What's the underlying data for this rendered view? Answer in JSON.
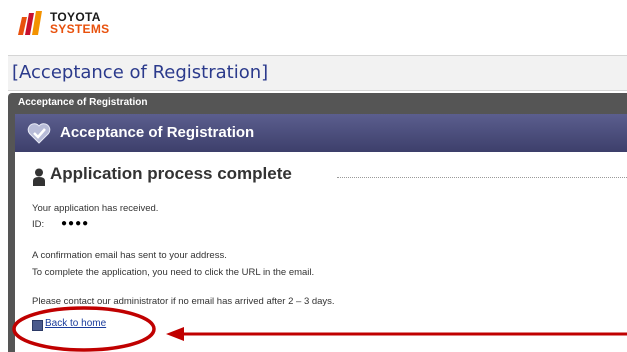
{
  "brand": {
    "line1": "TOYOTA",
    "line2": "SYSTEMS",
    "colors": {
      "orange": "#e8510d",
      "red": "#c8102e"
    }
  },
  "page": {
    "title": "[Acceptance of Registration]"
  },
  "panel": {
    "outer_header": "Acceptance of Registration",
    "inner_title": "Acceptance of Registration",
    "header_icon": "heart-check-icon"
  },
  "section": {
    "title": "Application process complete",
    "icon": "person-icon"
  },
  "body": {
    "received": "Your application has received.",
    "id_label": "ID:",
    "id_value": "●●●●",
    "confirm_line1": "A confirmation email has sent to your address.",
    "confirm_line2": "To complete the application, you need to click the URL in the email.",
    "contact": "Please contact our administrator if no email has arrived after 2 – 3 days."
  },
  "back_link": {
    "label": "Back to home",
    "icon": "back-square-icon"
  },
  "annotation": {
    "color": "#c00000",
    "highlight": "ellipse-around-back-to-home",
    "arrow": "arrow-pointing-left"
  }
}
